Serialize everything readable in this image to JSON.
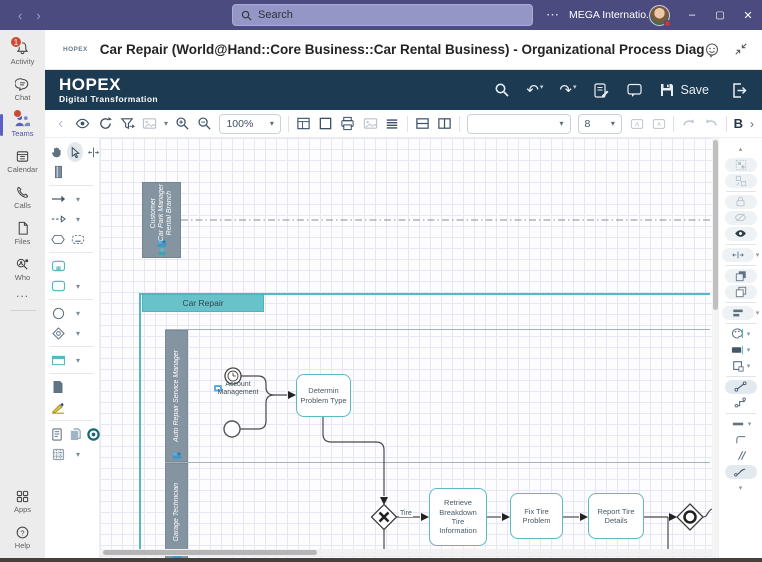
{
  "window": {
    "back": "‹",
    "forward": "›",
    "search_placeholder": "Search",
    "more": "⋯",
    "org_name": "MEGA Internatio...",
    "minimize": "–",
    "maximize": "▢",
    "close": "✕"
  },
  "rail": {
    "items": [
      {
        "label": "Activity",
        "badge": "1"
      },
      {
        "label": "Chat"
      },
      {
        "label": "Teams"
      },
      {
        "label": "Calendar"
      },
      {
        "label": "Calls"
      },
      {
        "label": "Files"
      },
      {
        "label": "Who"
      },
      {
        "label": "..."
      },
      {
        "label": "Apps"
      },
      {
        "label": "Help"
      }
    ]
  },
  "app_header": {
    "logo": "HOPEX",
    "title": "Car Repair (World@Hand::Core Business::Car Rental Business) - Organizational Process Diagram"
  },
  "hopex_bar": {
    "brand": "HOPEX",
    "subtitle": "Digital Transformation",
    "save_label": "Save",
    "undo_glyph": "↶",
    "redo_glyph": "↷"
  },
  "toolbar": {
    "zoom_value": "100%",
    "font_family_value": "",
    "font_size_value": "8",
    "bold_label": "B",
    "overflow_glyph": "›",
    "back_glyph": "‹"
  },
  "icons": {
    "chevron_down": "▾",
    "chevron_up": "▴"
  },
  "diagram": {
    "customer_pool": {
      "line1": "Customer",
      "line2": "Car Park Manager",
      "line3": "Rental Branch"
    },
    "pool": {
      "title": "Car Repair",
      "lane1": "Auto Repair Service Manager",
      "lane2": "Garage Technician"
    },
    "nodes": {
      "account": "Account Management",
      "task_determine": "Determin Problem Type",
      "task_retrieve": "Retrieve Breakdown Tire Information",
      "task_fix": "Fix Tire Problem",
      "task_report": "Report Tire Details"
    },
    "edge_labels": {
      "tire": "Tire"
    }
  },
  "colors": {
    "teams_purple": "#4b4b7f",
    "teams_accent": "#5b5fc7",
    "hopex_navy": "#1c3a52",
    "pool_teal": "#56b9c1",
    "lane_gray": "#8494a0",
    "badge_red": "#cc4a31",
    "grid": "#e7e7f3"
  }
}
